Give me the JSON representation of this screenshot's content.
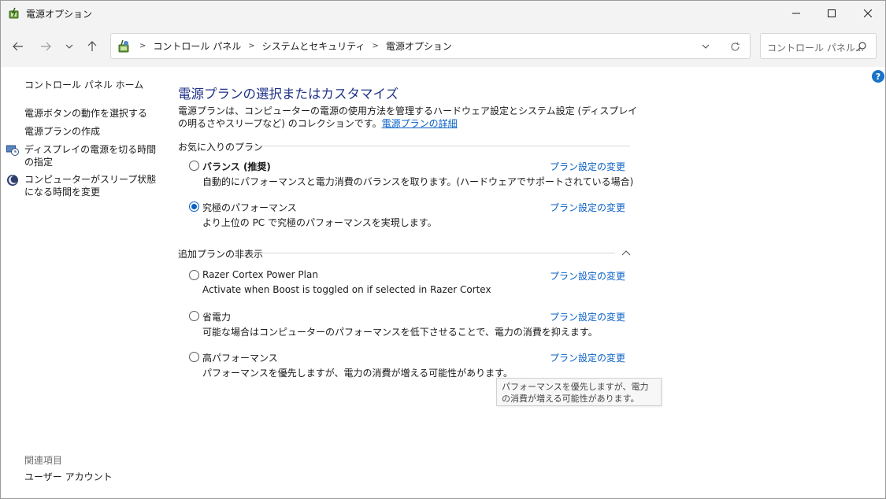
{
  "window": {
    "title": "電源オプション"
  },
  "nav": {
    "breadcrumbs": [
      "コントロール パネル",
      "システムとセキュリティ",
      "電源オプション"
    ],
    "search_placeholder": "コントロール パネル..."
  },
  "sidebar": {
    "home": "コントロール パネル ホーム",
    "items": [
      {
        "label": "電源ボタンの動作を選択する",
        "icon": "none"
      },
      {
        "label": "電源プランの作成",
        "icon": "none"
      },
      {
        "label": "ディスプレイの電源を切る時間の指定",
        "icon": "display-clock-icon"
      },
      {
        "label": "コンピューターがスリープ状態になる時間を変更",
        "icon": "moon-icon"
      }
    ],
    "related_heading": "関連項目",
    "related_items": [
      "ユーザー アカウント"
    ]
  },
  "main": {
    "title": "電源プランの選択またはカスタマイズ",
    "description": "電源プランは、コンピューターの電源の使用方法を管理するハードウェア設定とシステム設定 (ディスプレイの明るさやスリープなど) のコレクションです。",
    "description_link": "電源プランの詳細",
    "favorites_heading": "お気に入りのプラン",
    "favorites": [
      {
        "name": "バランス (推奨)",
        "bold": true,
        "selected": false,
        "description": "自動的にパフォーマンスと電力消費のバランスを取ります。(ハードウェアでサポートされている場合)",
        "link": "プラン設定の変更"
      },
      {
        "name": "究極のパフォーマンス",
        "bold": false,
        "selected": true,
        "description": "より上位の PC で究極のパフォーマンスを実現します。",
        "link": "プラン設定の変更"
      }
    ],
    "extra_heading": "追加プランの非表示",
    "extra": [
      {
        "name": "Razer Cortex Power Plan",
        "selected": false,
        "description": "Activate when Boost is toggled on if selected in Razer Cortex",
        "link": "プラン設定の変更"
      },
      {
        "name": "省電力",
        "selected": false,
        "description": "可能な場合はコンピューターのパフォーマンスを低下させることで、電力の消費を抑えます。",
        "link": "プラン設定の変更"
      },
      {
        "name": "高パフォーマンス",
        "selected": false,
        "description": "パフォーマンスを優先しますが、電力の消費が増える可能性があります。",
        "link": "プラン設定の変更"
      }
    ],
    "tooltip": "パフォーマンスを優先しますが、電力の消費が増える可能性があります。"
  },
  "colors": {
    "title_blue": "#1e3287",
    "link_blue": "#0a62c7",
    "radio_blue": "#0a5fc2",
    "chrome_bg": "#f3f3f3"
  }
}
